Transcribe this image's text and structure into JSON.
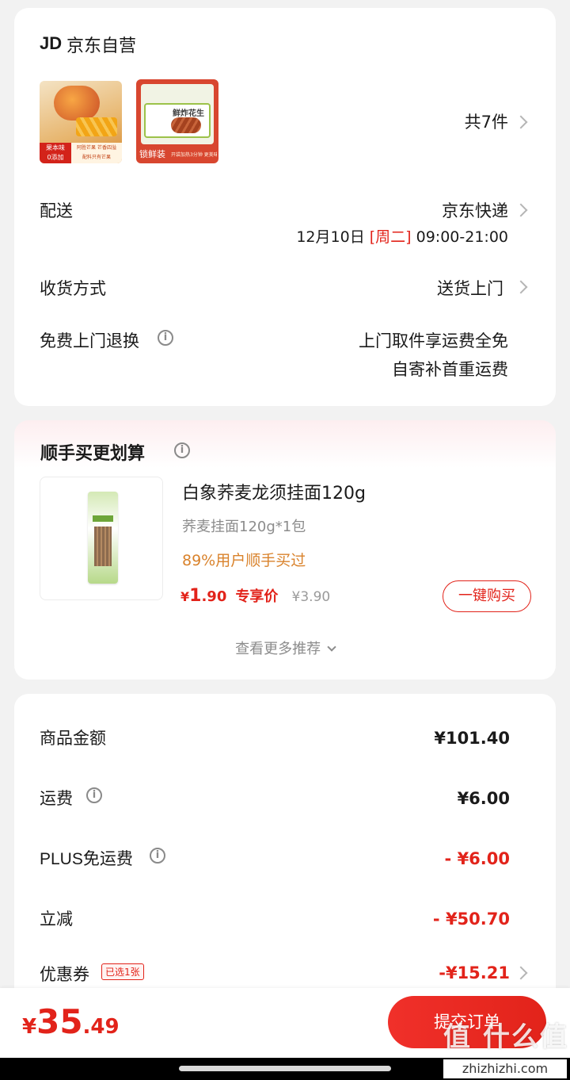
{
  "shop": {
    "logo_text": "JD",
    "name": "京东自营",
    "item_count": "共7件"
  },
  "product_thumbs": [
    {
      "label_tag": "果本味",
      "label_tag2": "0添加",
      "caption": "阿胜芒果 芒香四溢",
      "caption2": "配料只有芒果"
    },
    {
      "brand_tag": "锁鲜装",
      "big": "鲜炸花生",
      "caption": "开袋加热3分钟 更美味"
    }
  ],
  "delivery": {
    "label": "配送",
    "carrier": "京东快递",
    "date": "12月10日",
    "weekday": "[周二]",
    "time": "09:00-21:00"
  },
  "receive": {
    "label": "收货方式",
    "value": "送货上门"
  },
  "returns": {
    "label": "免费上门退换",
    "line1": "上门取件享运费全免",
    "line2": "自寄补首重运费"
  },
  "recommend": {
    "title": "顺手买更划算",
    "product_name": "白象荞麦龙须挂面120g",
    "spec": "荞麦挂面120g*1包",
    "social_proof": "89%用户顺手买过",
    "price_symbol": "¥",
    "price_int": "1",
    "price_dec": ".90",
    "price_tag": "专享价",
    "orig_price": "¥3.90",
    "buy_button": "一键购买",
    "more": "查看更多推荐"
  },
  "summary": {
    "goods_label": "商品金额",
    "goods_value": "¥101.40",
    "shipping_label": "运费",
    "shipping_value": "¥6.00",
    "plus_label": "PLUS免运费",
    "plus_value": "- ¥6.00",
    "discount_label": "立减",
    "discount_value": "- ¥50.70",
    "coupon_label": "优惠券",
    "coupon_badge": "已选1张",
    "coupon_value": "-¥15.21"
  },
  "footer": {
    "total_symbol": "¥",
    "total_int": "35",
    "total_dec": ".49",
    "submit_label": "提交订单",
    "watermark": "值 什么值得买",
    "watermark_url": "zhizhizhi.com"
  },
  "colors": {
    "accent_red": "#e2231a",
    "orange": "#d9822b"
  }
}
